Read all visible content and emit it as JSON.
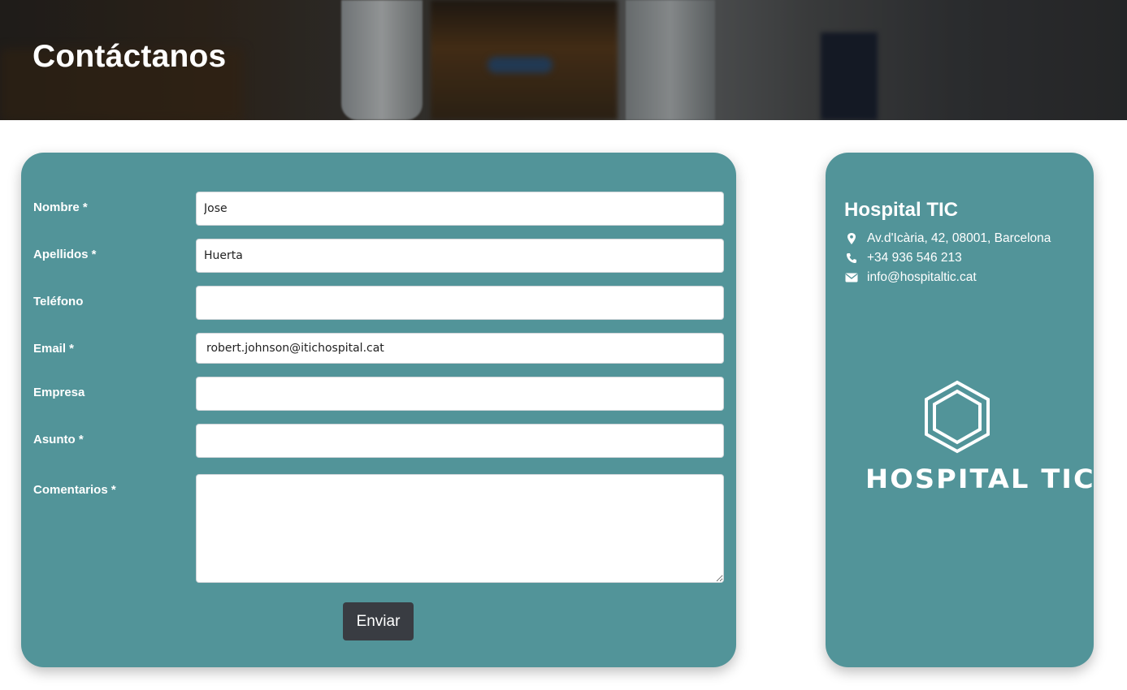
{
  "hero": {
    "title": "Contáctanos"
  },
  "form": {
    "fields": [
      {
        "label": "Nombre *",
        "value": "Jose"
      },
      {
        "label": "Apellidos *",
        "value": "Huerta"
      },
      {
        "label": "Teléfono",
        "value": ""
      },
      {
        "label": "Email *",
        "value": "robert.johnson@itichospital.cat"
      },
      {
        "label": "Empresa",
        "value": ""
      },
      {
        "label": "Asunto *",
        "value": ""
      },
      {
        "label": "Comentarios *",
        "value": ""
      }
    ],
    "submit_label": "Enviar"
  },
  "info": {
    "title": "Hospital TIC",
    "address": "Av.d'Icària, 42, 08001, Barcelona",
    "phone": "+34 936 546 213",
    "email": "info@hospitaltic.cat",
    "logo_text": "HOSPITAL TIC",
    "icons": [
      "map-marker-icon",
      "phone-icon",
      "envelope-icon"
    ]
  },
  "colors": {
    "card_bg": "#529499",
    "button_bg": "#393c42",
    "text_light": "#ffffff"
  }
}
